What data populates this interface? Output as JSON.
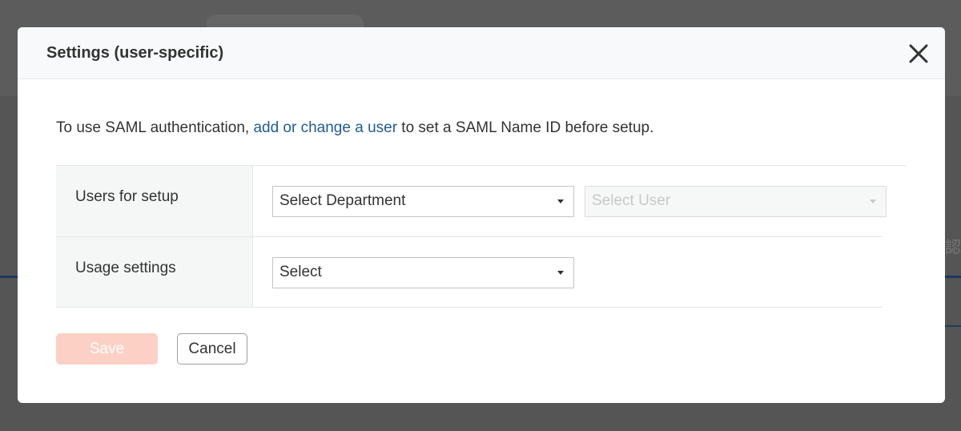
{
  "dialog": {
    "title": "Settings (user-specific)",
    "close_icon": "close-icon"
  },
  "intro": {
    "prefix": "To use SAML authentication, ",
    "link": "add or change a user",
    "suffix": " to set a SAML Name ID before setup."
  },
  "form": {
    "rows": [
      {
        "label": "Users for setup",
        "department_select": "Select Department",
        "user_select": "Select User"
      },
      {
        "label": "Usage settings",
        "usage_select": "Select"
      }
    ]
  },
  "buttons": {
    "save": "Save",
    "cancel": "Cancel"
  },
  "background": {
    "glyph": "認"
  },
  "colors": {
    "link": "#1f5c99",
    "save_disabled": "#fdd0c5",
    "overlay": "#5a5a5a"
  }
}
